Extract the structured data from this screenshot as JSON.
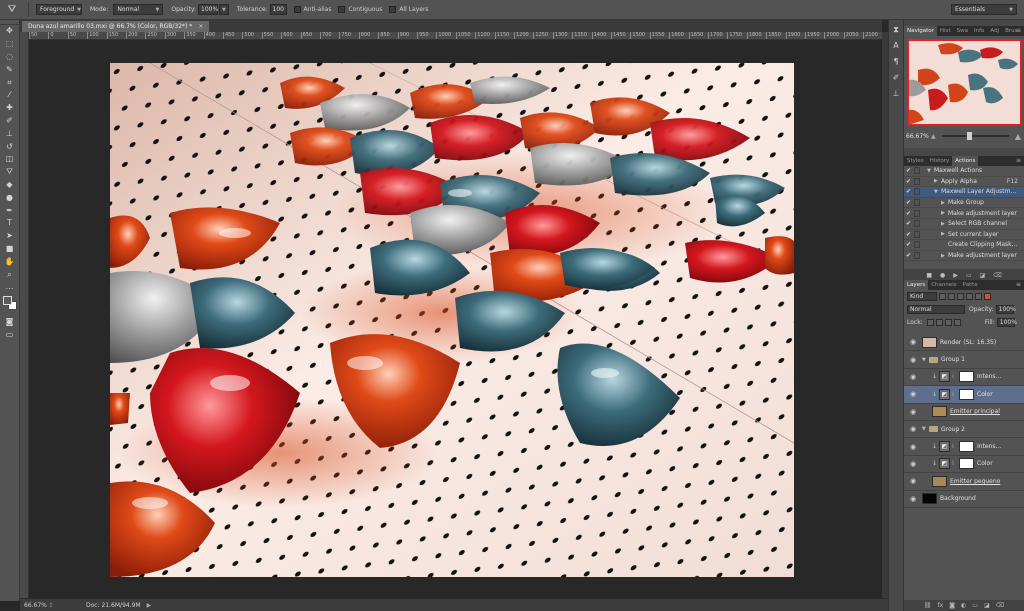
{
  "options_bar": {
    "preset": "Foreground",
    "mode_label": "Mode:",
    "mode": "Normal",
    "opacity_label": "Opacity:",
    "opacity": "100%",
    "tolerance_label": "Tolerance:",
    "tolerance": "100",
    "anti_alias": "Anti-alias",
    "contiguous": "Contiguous",
    "all_layers": "All Layers",
    "workspace": "Essentials"
  },
  "document": {
    "tab_title": "Duna azul amarillo 03.mxi @ 66.7% (Color, RGB/32*) *",
    "close": "×"
  },
  "ruler": {
    "h_ticks": [
      "50",
      "0",
      "50",
      "100",
      "150",
      "200",
      "250",
      "300",
      "350",
      "400",
      "450",
      "500",
      "550",
      "600",
      "650",
      "700",
      "750",
      "800",
      "850",
      "900",
      "950",
      "1000",
      "1050",
      "1100",
      "1150",
      "1200",
      "1250",
      "1300",
      "1350",
      "1400",
      "1450",
      "1500",
      "1550",
      "1600",
      "1650",
      "1700",
      "1750",
      "1800",
      "1850",
      "1900",
      "1950",
      "2000",
      "2050",
      "2100"
    ]
  },
  "status_bar": {
    "zoom": "66.67%",
    "doc": "Doc: 21.6M/94.9M"
  },
  "navigator": {
    "tabs": [
      "Navigator",
      "Hist",
      "Swa",
      "Info",
      "Adj",
      "Brus"
    ],
    "zoom": "66.67%"
  },
  "actions": {
    "tabs": [
      "Styles",
      "History",
      "Actions"
    ],
    "rows": [
      {
        "label": "Maxwell Actions",
        "indent": 1,
        "key": "",
        "selected": false,
        "twirl": "▼"
      },
      {
        "label": "Apply Alpha",
        "indent": 2,
        "key": "F12",
        "selected": false,
        "twirl": "▶"
      },
      {
        "label": "Maxwell Layer Adjustm...",
        "indent": 2,
        "key": "",
        "selected": true,
        "twirl": "▼"
      },
      {
        "label": "Make Group",
        "indent": 3,
        "key": "",
        "selected": false,
        "twirl": "▶"
      },
      {
        "label": "Make adjustment layer",
        "indent": 3,
        "key": "",
        "selected": false,
        "twirl": "▶"
      },
      {
        "label": "Select RGB channel",
        "indent": 3,
        "key": "",
        "selected": false,
        "twirl": "▶"
      },
      {
        "label": "Set current layer",
        "indent": 3,
        "key": "",
        "selected": false,
        "twirl": "▶"
      },
      {
        "label": "Create Clipping Mask...",
        "indent": 3,
        "key": "",
        "selected": false,
        "twirl": ""
      },
      {
        "label": "Make adjustment layer",
        "indent": 3,
        "key": "",
        "selected": false,
        "twirl": "▶"
      }
    ]
  },
  "layers": {
    "tabs": [
      "Layers",
      "Channels",
      "Paths"
    ],
    "kind": "Kind",
    "blend": "Normal",
    "opacity_label": "Opacity:",
    "opacity": "100%",
    "lock_label": "Lock:",
    "fill_label": "Fill:",
    "fill": "100%",
    "items": [
      {
        "name": "Render (SL: 16.35)",
        "type": "pixel",
        "indent": 0,
        "selected": false,
        "underline": false,
        "thumb": "#d7b7a6"
      },
      {
        "name": "Group 1",
        "type": "group",
        "indent": 0,
        "selected": false,
        "underline": false,
        "thumb": ""
      },
      {
        "name": "Intens...",
        "type": "adjust",
        "indent": 1,
        "selected": false,
        "underline": false,
        "thumb": ""
      },
      {
        "name": "Color",
        "type": "adjust",
        "indent": 1,
        "selected": true,
        "underline": false,
        "thumb": ""
      },
      {
        "name": "Emitter principal",
        "type": "pixel",
        "indent": 1,
        "selected": false,
        "underline": true,
        "thumb": "#b08a53"
      },
      {
        "name": "Group 2",
        "type": "group",
        "indent": 0,
        "selected": false,
        "underline": false,
        "thumb": ""
      },
      {
        "name": "Intens...",
        "type": "adjust",
        "indent": 1,
        "selected": false,
        "underline": false,
        "thumb": ""
      },
      {
        "name": "Color",
        "type": "adjust",
        "indent": 1,
        "selected": false,
        "underline": false,
        "thumb": ""
      },
      {
        "name": "Emitter pequeno",
        "type": "pixel",
        "indent": 1,
        "selected": false,
        "underline": true,
        "thumb": "#a9875a"
      },
      {
        "name": "Background",
        "type": "pixel",
        "indent": 0,
        "selected": false,
        "underline": false,
        "thumb": "#050505"
      }
    ]
  },
  "icons": {
    "tools": [
      "move-icon",
      "marquee-icon",
      "lasso-icon",
      "quick-select-icon",
      "crop-icon",
      "eyedropper-icon",
      "healing-icon",
      "brush-icon",
      "stamp-icon",
      "history-brush-icon",
      "eraser-icon",
      "paint-bucket-icon",
      "blur-icon",
      "dodge-icon",
      "pen-icon",
      "type-icon",
      "path-select-icon",
      "shape-icon",
      "hand-icon",
      "zoom-icon",
      "ellipsis-icon",
      "swap-colors-icon",
      "color-swatches-icon",
      "quick-mask-icon",
      "screen-mode-icon"
    ],
    "colors": {
      "foreground": "#5a5a5a",
      "background": "#ffffff",
      "selection": "#5d6f8c",
      "navigator_frame": "#e62020"
    }
  }
}
